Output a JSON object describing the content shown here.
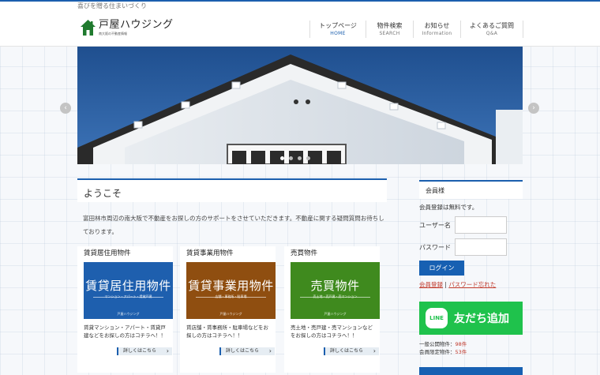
{
  "site": {
    "tagline": "喜びを贈る住まいづくり",
    "logo_title": "戸屋ハウジング",
    "logo_sub": "南大阪の不動産情報"
  },
  "nav": [
    {
      "jp": "トップページ",
      "en": "HOME"
    },
    {
      "jp": "物件検索",
      "en": "SEARCH"
    },
    {
      "jp": "お知らせ",
      "en": "Information"
    },
    {
      "jp": "よくあるご質問",
      "en": "Q&A"
    }
  ],
  "hero": {
    "prev": "‹",
    "next": "›",
    "slides": 4,
    "active_slide": 0
  },
  "main": {
    "welcome_title": "ようこそ",
    "intro": "富田林市周辺の南大阪で不動産をお探しの方のサポートをさせていただきます。不動産に関する疑問質問お待ちしております。",
    "cards": [
      {
        "title": "賃貸居住用物件",
        "banner_title": "賃貸居住用物件",
        "banner_sub": "マンション・アパート・賃貸戸建",
        "banner_foot": "戸屋ハウジング",
        "color": "#1e5fae",
        "desc": "賃貸マンション・アパート・賃貸戸建などをお探しの方はコチラへ！！",
        "more": "詳しくはこちら"
      },
      {
        "title": "賃貸事業用物件",
        "banner_title": "賃貸事業用物件",
        "banner_sub": "店舗・事務所・駐車場",
        "banner_foot": "戸屋ハウジング",
        "color": "#8f4e10",
        "desc": "賃店舗・賃事務所・駐車場などをお探しの方はコチラへ！！",
        "more": "詳しくはこちら"
      },
      {
        "title": "売買物件",
        "banner_title": "売買物件",
        "banner_sub": "売土地・売戸建・売マンション",
        "banner_foot": "戸屋ハウジング",
        "color": "#3f8a1e",
        "desc": "売土地・売戸建・売マンションなどをお探しの方はコチラへ！！",
        "more": "詳しくはこちら"
      }
    ]
  },
  "side": {
    "heading": "会員様",
    "free_note": "会員登録は無料です。",
    "username_label": "ユーザー名",
    "password_label": "パスワード",
    "login_label": "ログイン",
    "register_link": "会員登録",
    "separator": "|",
    "forgot_link": "パスワード忘れた",
    "line_logo": "LINE",
    "line_text": "友だち追加",
    "stats": [
      {
        "label": "一般公開物件：",
        "value": "98件"
      },
      {
        "label": "会員限定物件：",
        "value": "53件"
      }
    ]
  },
  "colors": {
    "accent": "#1b5fae",
    "line_green": "#1fc24c",
    "link_red": "#c0392b"
  }
}
